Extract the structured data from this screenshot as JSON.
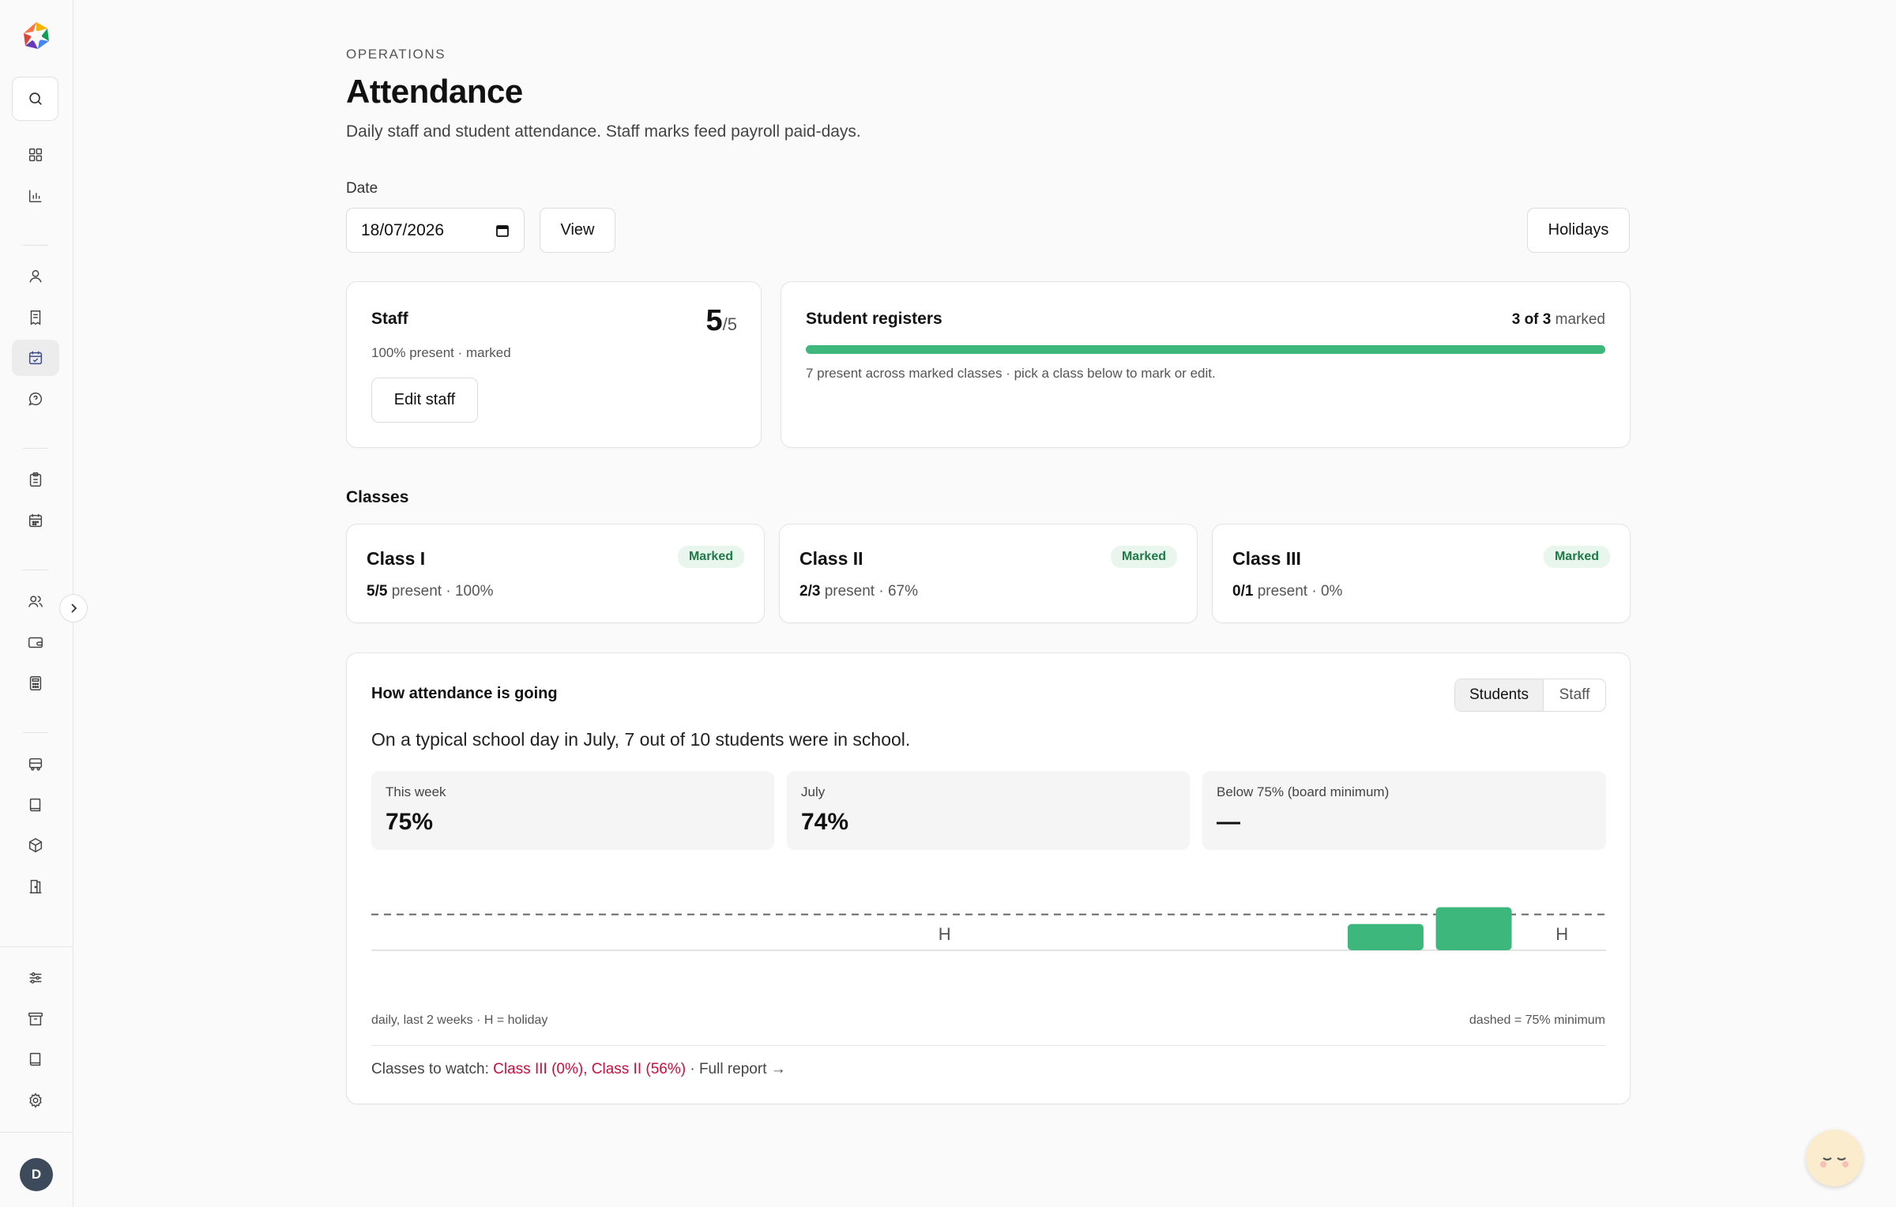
{
  "sidebar": {
    "avatar_initial": "D",
    "icons": [
      "search-icon",
      "dashboard-icon",
      "chart-icon",
      "person-icon",
      "receipt-icon",
      "calendar-check-icon",
      "chat-icon",
      "clipboard-icon",
      "calendar-icon",
      "users-icon",
      "wallet-icon",
      "calculator-icon",
      "bus-icon",
      "book-icon",
      "box-icon",
      "door-icon",
      "sliders-icon",
      "archive-icon",
      "notebook-icon",
      "gear-icon"
    ]
  },
  "header": {
    "eyebrow": "OPERATIONS",
    "title": "Attendance",
    "subtitle": "Daily staff and student attendance. Staff marks feed payroll paid-days."
  },
  "controls": {
    "date_label": "Date",
    "date_value": "18/07/2026",
    "view_label": "View",
    "holidays_label": "Holidays"
  },
  "staff_card": {
    "title": "Staff",
    "present": "5",
    "total": "/5",
    "status": "100% present · marked",
    "edit_label": "Edit staff"
  },
  "registers_card": {
    "title": "Student registers",
    "marked_count": "3 of 3",
    "marked_suffix": " marked",
    "progress": 1.0,
    "note": "7 present across marked classes · pick a class below to mark or edit."
  },
  "classes": {
    "title": "Classes",
    "items": [
      {
        "name": "Class I",
        "badge": "Marked",
        "count": "5/5",
        "suffix": " present · 100%"
      },
      {
        "name": "Class II",
        "badge": "Marked",
        "count": "2/3",
        "suffix": " present · 67%"
      },
      {
        "name": "Class III",
        "badge": "Marked",
        "count": "0/1",
        "suffix": " present · 0%"
      }
    ]
  },
  "trend": {
    "title": "How attendance is going",
    "toggle_students": "Students",
    "toggle_staff": "Staff",
    "summary": "On a typical school day in July, 7 out of 10 students were in school.",
    "stats": [
      {
        "label": "This week",
        "value": "75%"
      },
      {
        "label": "July",
        "value": "74%"
      },
      {
        "label": "Below 75% (board minimum)",
        "value": "—"
      }
    ],
    "footnote_left": "daily, last 2 weeks · H = holiday",
    "footnote_right": "dashed = 75% minimum",
    "watch_prefix": "Classes to watch: ",
    "watch_classes": "Class III (0%), Class II (56%)",
    "watch_sep": " · ",
    "full_report": "Full report →"
  },
  "chart_data": {
    "type": "bar",
    "threshold": 75,
    "ylim": [
      0,
      100
    ],
    "days": [
      {
        "value": null,
        "holiday": false
      },
      {
        "value": null,
        "holiday": false
      },
      {
        "value": null,
        "holiday": false
      },
      {
        "value": null,
        "holiday": false
      },
      {
        "value": null,
        "holiday": false
      },
      {
        "value": null,
        "holiday": false
      },
      {
        "value": null,
        "holiday": true,
        "label": "H"
      },
      {
        "value": null,
        "holiday": false
      },
      {
        "value": null,
        "holiday": false
      },
      {
        "value": null,
        "holiday": false
      },
      {
        "value": null,
        "holiday": false
      },
      {
        "value": 55,
        "holiday": false
      },
      {
        "value": 90,
        "holiday": false
      },
      {
        "value": null,
        "holiday": true,
        "label": "H"
      }
    ]
  },
  "colors": {
    "accent_green": "#3db77c",
    "watch_red": "#c8103c"
  }
}
